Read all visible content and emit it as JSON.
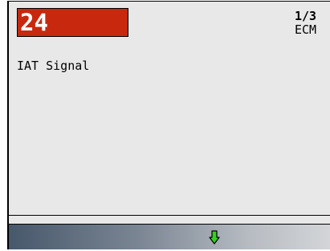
{
  "header": {
    "code": "24",
    "page_indicator": "1/3",
    "module": "ECM"
  },
  "body": {
    "description": "IAT Signal"
  },
  "nav": {
    "icon": "arrow-down-icon",
    "icon_color": "#32d21e"
  },
  "colors": {
    "code_background": "#c8290e",
    "screen_background": "#e8e8e8"
  }
}
